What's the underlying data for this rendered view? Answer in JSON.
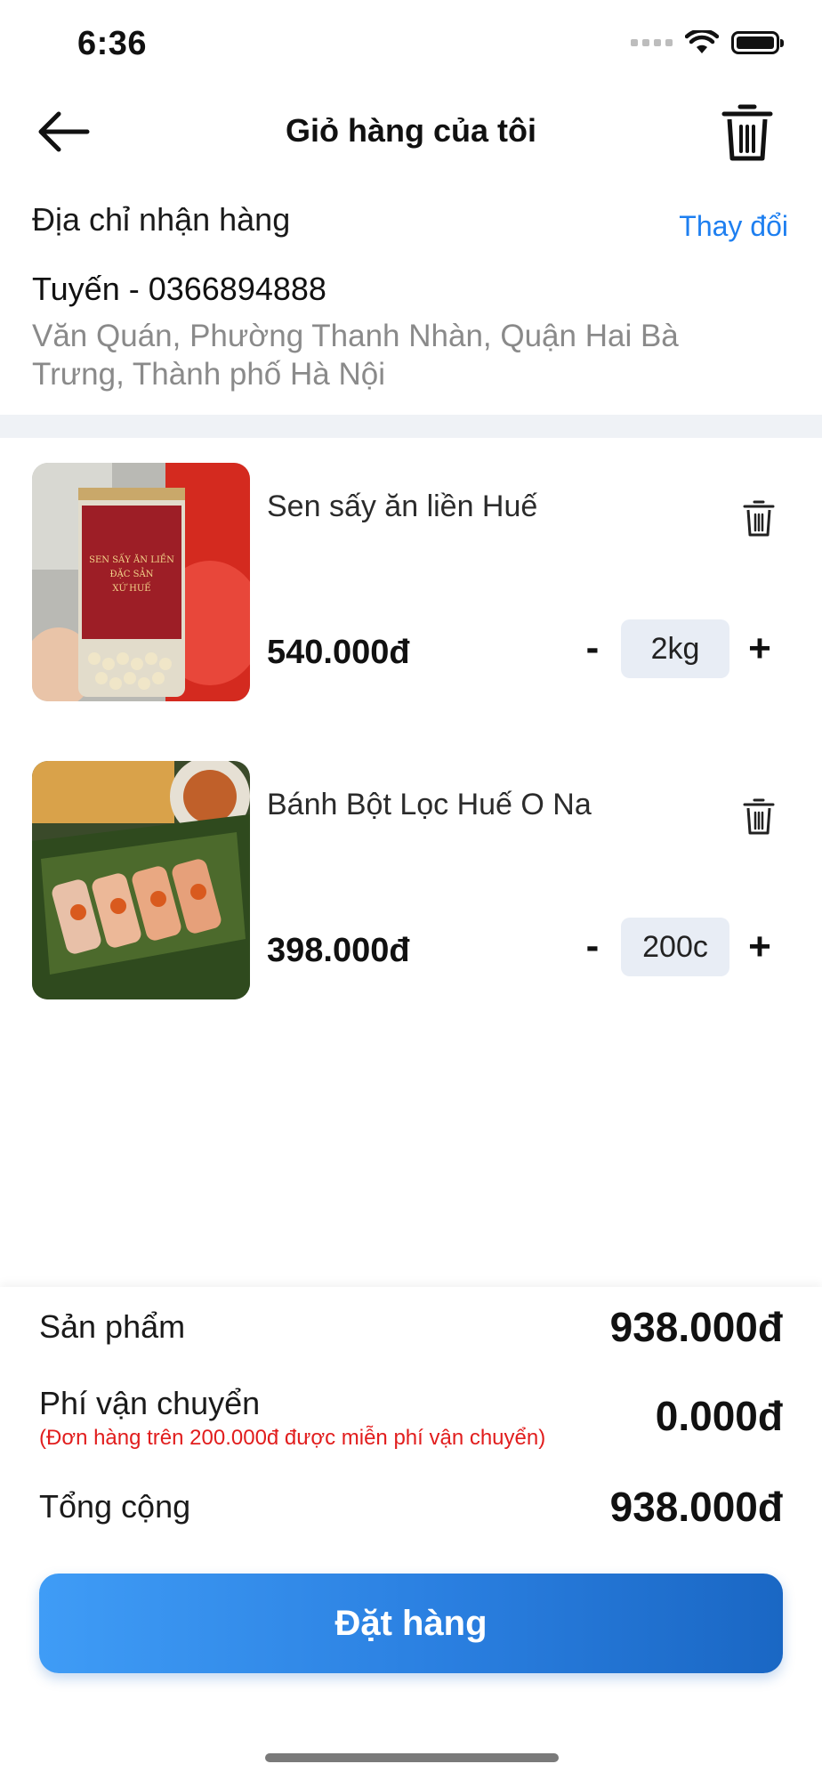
{
  "status_bar": {
    "time": "6:36"
  },
  "header": {
    "title": "Giỏ hàng của tôi"
  },
  "address": {
    "label": "Địa chỉ nhận hàng",
    "change_label": "Thay đổi",
    "name_phone": "Tuyến - 0366894888",
    "detail": "Văn Quán, Phường Thanh Nhàn, Quận Hai Bà Trưng, Thành phố Hà Nội"
  },
  "items": [
    {
      "name": "Sen sấy ăn liền Huế",
      "price": "540.000đ",
      "quantity": "2kg",
      "minus": "-",
      "plus": "+"
    },
    {
      "name": "Bánh Bột Lọc Huế O Na",
      "price": "398.000đ",
      "quantity": "200c",
      "minus": "-",
      "plus": "+"
    }
  ],
  "summary": {
    "products_label": "Sản phẩm",
    "products_value": "938.000đ",
    "shipping_label": "Phí vận chuyển",
    "shipping_note": "(Đơn hàng trên 200.000đ được miễn phí vận chuyển)",
    "shipping_value": "0.000đ",
    "total_label": "Tổng cộng",
    "total_value": "938.000đ"
  },
  "order_button": {
    "label": "Đặt hàng"
  },
  "colors": {
    "accent": "#1e7ff0",
    "note": "#e11d1d",
    "qty_bg": "#e8edf5",
    "divider": "#eff2f6"
  }
}
